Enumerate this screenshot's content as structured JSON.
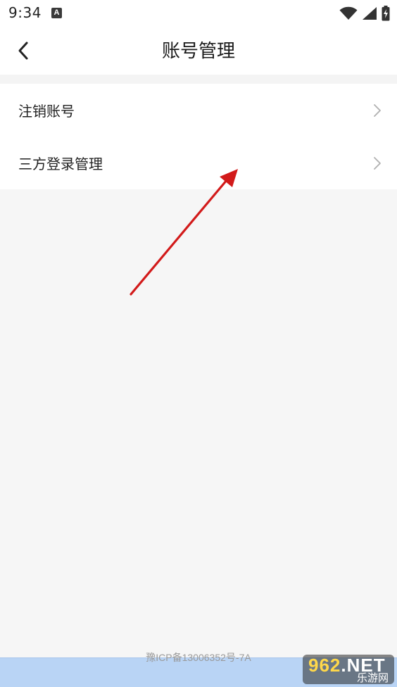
{
  "status_bar": {
    "time": "9:34",
    "notification_glyph": "A",
    "icons": [
      "wifi-icon",
      "cellular-signal-icon",
      "battery-charging-icon"
    ]
  },
  "header": {
    "title": "账号管理",
    "back_icon": "chevron-left-icon"
  },
  "menu": {
    "items": [
      {
        "label": "注销账号",
        "icon": "chevron-right-icon"
      },
      {
        "label": "三方登录管理",
        "icon": "chevron-right-icon"
      }
    ]
  },
  "footer": {
    "icp": "豫ICP备13006352号-7A"
  },
  "watermark": {
    "brand_number": "962",
    "brand_suffix": ".NET",
    "brand_cn": "乐游网"
  },
  "colors": {
    "background": "#f6f6f6",
    "surface": "#ffffff",
    "annotation_arrow": "#d21a1a",
    "chevron": "#b0b0b0",
    "bottom_band": "#b9d4f5"
  }
}
